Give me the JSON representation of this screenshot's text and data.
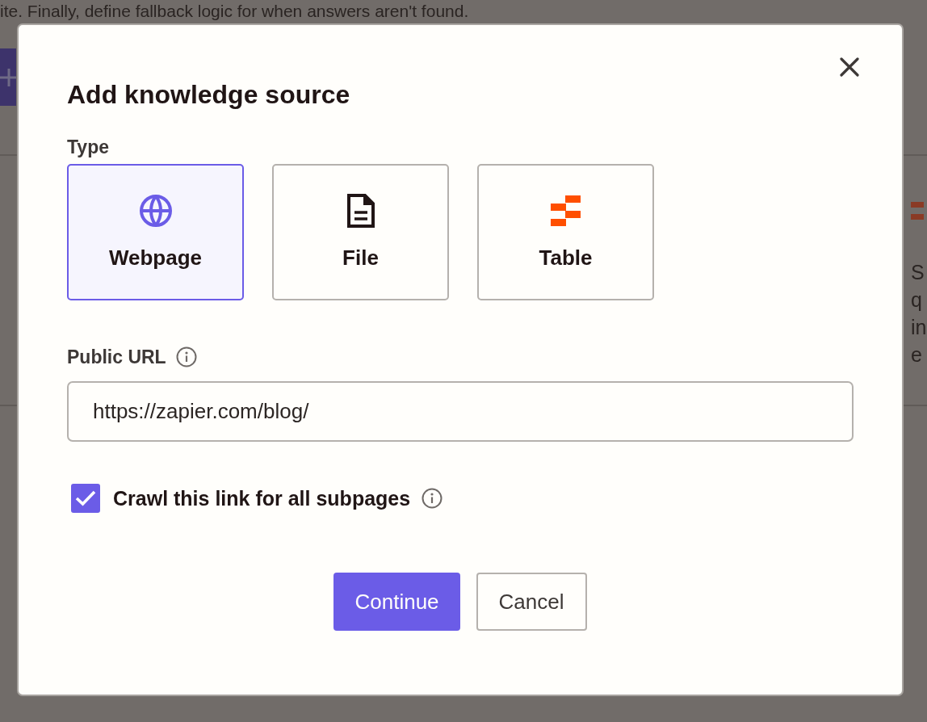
{
  "background": {
    "intro_text": "ite. Finally, define fallback logic for when answers aren't found.",
    "right_fragments": [
      "S",
      "q",
      "in",
      "e"
    ]
  },
  "dialog": {
    "title": "Add knowledge source",
    "type_label": "Type",
    "types": [
      {
        "kind": "webpage",
        "label": "Webpage",
        "selected": true
      },
      {
        "kind": "file",
        "label": "File",
        "selected": false
      },
      {
        "kind": "table",
        "label": "Table",
        "selected": false
      }
    ],
    "url_field": {
      "label": "Public URL",
      "value": "https://zapier.com/blog/"
    },
    "crawl": {
      "label": "Crawl this link for all subpages",
      "checked": true
    },
    "buttons": [
      {
        "kind": "primary",
        "label": "Continue"
      },
      {
        "kind": "secondary",
        "label": "Cancel"
      }
    ]
  }
}
